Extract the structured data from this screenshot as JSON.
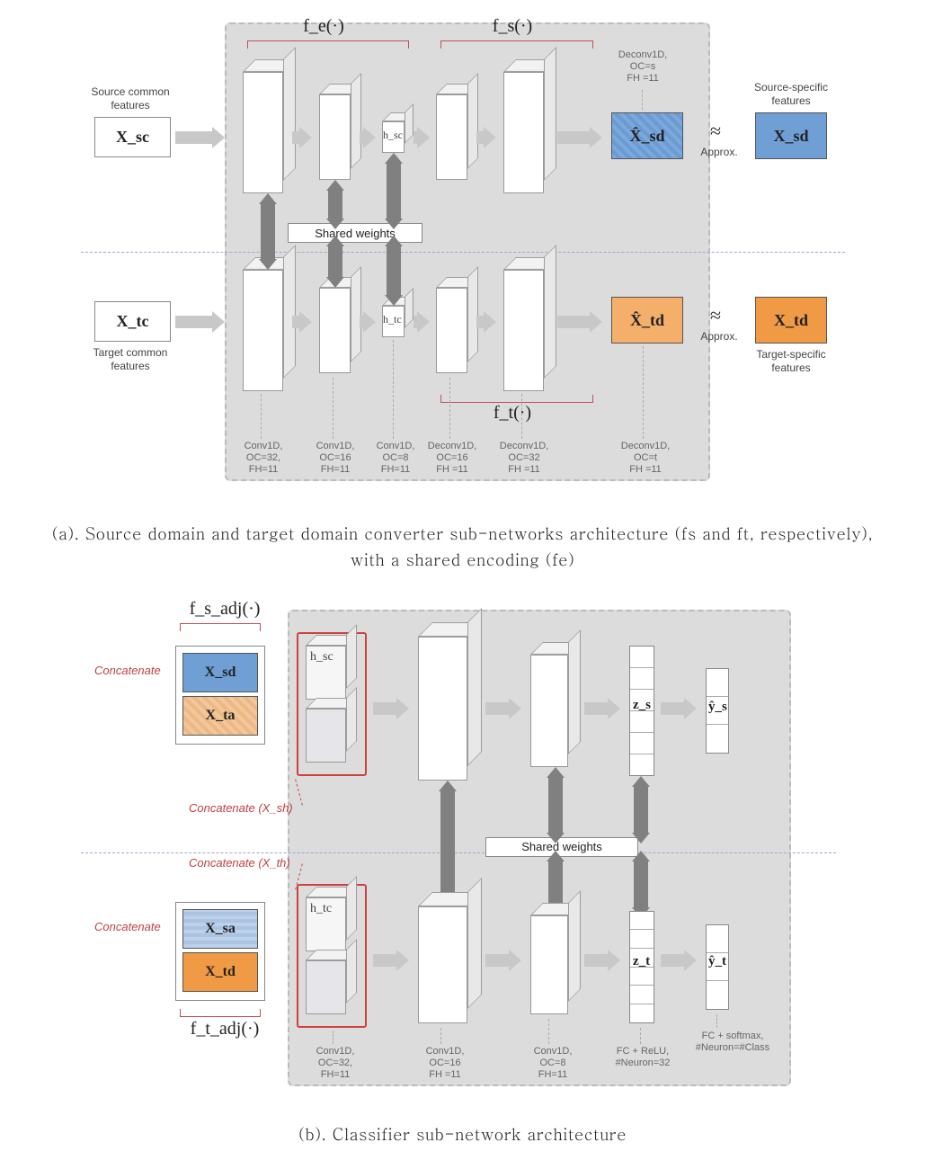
{
  "figA": {
    "fe_label": "f_e(·)",
    "fs_label": "f_s(·)",
    "ft_label": "f_t(·)",
    "source_common_label": "Source common\nfeatures",
    "target_common_label": "Target common\nfeatures",
    "source_specific_label": "Source-specific\nfeatures",
    "target_specific_label": "Target-specific\nfeatures",
    "xsc": "X_sc",
    "xtc": "X_tc",
    "xsd_hat": "X̂_sd",
    "xsd": "X_sd",
    "xtd_hat": "X̂_td",
    "xtd": "X_td",
    "hsc": "h_sc",
    "htc": "h_tc",
    "approx": "≈",
    "approx_text": "Approx.",
    "shared_weights": "Shared weights",
    "top_spec": "Deconv1D,\nOC=s\nFH =11",
    "specs": [
      "Conv1D,\nOC=32,\nFH=11",
      "Conv1D,\nOC=16\nFH=11",
      "Conv1D,\nOC=8\nFH=11",
      "Deconv1D,\nOC=16\nFH =11",
      "Deconv1D,\nOC=32\nFH =11",
      "Deconv1D,\nOC=t\nFH =11"
    ]
  },
  "captionA": "(a). Source domain and target domain converter sub-networks architecture (fs and ft, respectively), with a shared encoding (fe)",
  "figB": {
    "fsadj": "f_s_adj(·)",
    "ftadj": "f_t_adj(·)",
    "concat_label": "Concatenate",
    "concat_xsh": "Concatenate (X_sh)",
    "concat_xth": "Concatenate (X_th)",
    "shared_weights": "Shared weights",
    "xsd": "X_sd",
    "xta": "X_ta",
    "xsa": "X_sa",
    "xtd": "X_td",
    "hsc": "h_sc",
    "htc": "h_tc",
    "zs": "z_s",
    "zt": "z_t",
    "ys": "ŷ_s",
    "yt": "ŷ_t",
    "specs": [
      "Conv1D,\nOC=32,\nFH=11",
      "Conv1D,\nOC=16\nFH =11",
      "Conv1D,\nOC=8\nFH=11",
      "FC + ReLU,\n#Neuron=32",
      "FC + softmax,\n#Neuron=#Class"
    ]
  },
  "captionB": "(b). Classifier sub-network architecture"
}
